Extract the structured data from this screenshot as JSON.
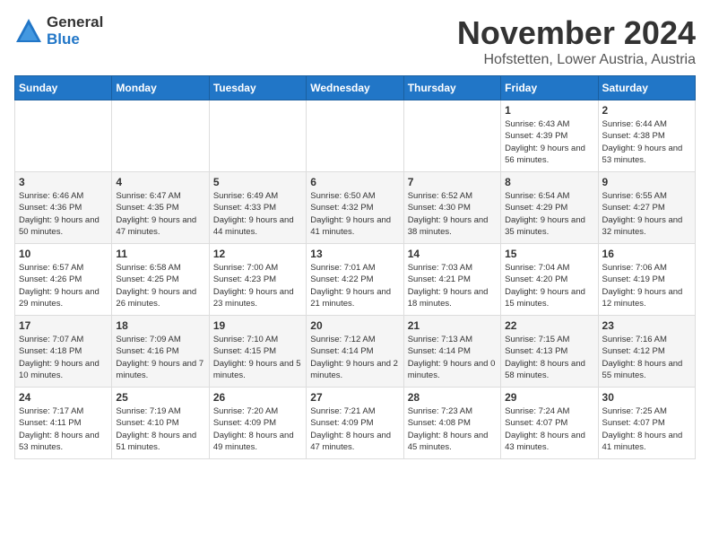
{
  "logo": {
    "general": "General",
    "blue": "Blue"
  },
  "header": {
    "month_title": "November 2024",
    "location": "Hofstetten, Lower Austria, Austria"
  },
  "calendar": {
    "days_of_week": [
      "Sunday",
      "Monday",
      "Tuesday",
      "Wednesday",
      "Thursday",
      "Friday",
      "Saturday"
    ],
    "weeks": [
      [
        {
          "day": "",
          "info": ""
        },
        {
          "day": "",
          "info": ""
        },
        {
          "day": "",
          "info": ""
        },
        {
          "day": "",
          "info": ""
        },
        {
          "day": "",
          "info": ""
        },
        {
          "day": "1",
          "info": "Sunrise: 6:43 AM\nSunset: 4:39 PM\nDaylight: 9 hours and 56 minutes."
        },
        {
          "day": "2",
          "info": "Sunrise: 6:44 AM\nSunset: 4:38 PM\nDaylight: 9 hours and 53 minutes."
        }
      ],
      [
        {
          "day": "3",
          "info": "Sunrise: 6:46 AM\nSunset: 4:36 PM\nDaylight: 9 hours and 50 minutes."
        },
        {
          "day": "4",
          "info": "Sunrise: 6:47 AM\nSunset: 4:35 PM\nDaylight: 9 hours and 47 minutes."
        },
        {
          "day": "5",
          "info": "Sunrise: 6:49 AM\nSunset: 4:33 PM\nDaylight: 9 hours and 44 minutes."
        },
        {
          "day": "6",
          "info": "Sunrise: 6:50 AM\nSunset: 4:32 PM\nDaylight: 9 hours and 41 minutes."
        },
        {
          "day": "7",
          "info": "Sunrise: 6:52 AM\nSunset: 4:30 PM\nDaylight: 9 hours and 38 minutes."
        },
        {
          "day": "8",
          "info": "Sunrise: 6:54 AM\nSunset: 4:29 PM\nDaylight: 9 hours and 35 minutes."
        },
        {
          "day": "9",
          "info": "Sunrise: 6:55 AM\nSunset: 4:27 PM\nDaylight: 9 hours and 32 minutes."
        }
      ],
      [
        {
          "day": "10",
          "info": "Sunrise: 6:57 AM\nSunset: 4:26 PM\nDaylight: 9 hours and 29 minutes."
        },
        {
          "day": "11",
          "info": "Sunrise: 6:58 AM\nSunset: 4:25 PM\nDaylight: 9 hours and 26 minutes."
        },
        {
          "day": "12",
          "info": "Sunrise: 7:00 AM\nSunset: 4:23 PM\nDaylight: 9 hours and 23 minutes."
        },
        {
          "day": "13",
          "info": "Sunrise: 7:01 AM\nSunset: 4:22 PM\nDaylight: 9 hours and 21 minutes."
        },
        {
          "day": "14",
          "info": "Sunrise: 7:03 AM\nSunset: 4:21 PM\nDaylight: 9 hours and 18 minutes."
        },
        {
          "day": "15",
          "info": "Sunrise: 7:04 AM\nSunset: 4:20 PM\nDaylight: 9 hours and 15 minutes."
        },
        {
          "day": "16",
          "info": "Sunrise: 7:06 AM\nSunset: 4:19 PM\nDaylight: 9 hours and 12 minutes."
        }
      ],
      [
        {
          "day": "17",
          "info": "Sunrise: 7:07 AM\nSunset: 4:18 PM\nDaylight: 9 hours and 10 minutes."
        },
        {
          "day": "18",
          "info": "Sunrise: 7:09 AM\nSunset: 4:16 PM\nDaylight: 9 hours and 7 minutes."
        },
        {
          "day": "19",
          "info": "Sunrise: 7:10 AM\nSunset: 4:15 PM\nDaylight: 9 hours and 5 minutes."
        },
        {
          "day": "20",
          "info": "Sunrise: 7:12 AM\nSunset: 4:14 PM\nDaylight: 9 hours and 2 minutes."
        },
        {
          "day": "21",
          "info": "Sunrise: 7:13 AM\nSunset: 4:14 PM\nDaylight: 9 hours and 0 minutes."
        },
        {
          "day": "22",
          "info": "Sunrise: 7:15 AM\nSunset: 4:13 PM\nDaylight: 8 hours and 58 minutes."
        },
        {
          "day": "23",
          "info": "Sunrise: 7:16 AM\nSunset: 4:12 PM\nDaylight: 8 hours and 55 minutes."
        }
      ],
      [
        {
          "day": "24",
          "info": "Sunrise: 7:17 AM\nSunset: 4:11 PM\nDaylight: 8 hours and 53 minutes."
        },
        {
          "day": "25",
          "info": "Sunrise: 7:19 AM\nSunset: 4:10 PM\nDaylight: 8 hours and 51 minutes."
        },
        {
          "day": "26",
          "info": "Sunrise: 7:20 AM\nSunset: 4:09 PM\nDaylight: 8 hours and 49 minutes."
        },
        {
          "day": "27",
          "info": "Sunrise: 7:21 AM\nSunset: 4:09 PM\nDaylight: 8 hours and 47 minutes."
        },
        {
          "day": "28",
          "info": "Sunrise: 7:23 AM\nSunset: 4:08 PM\nDaylight: 8 hours and 45 minutes."
        },
        {
          "day": "29",
          "info": "Sunrise: 7:24 AM\nSunset: 4:07 PM\nDaylight: 8 hours and 43 minutes."
        },
        {
          "day": "30",
          "info": "Sunrise: 7:25 AM\nSunset: 4:07 PM\nDaylight: 8 hours and 41 minutes."
        }
      ]
    ]
  }
}
